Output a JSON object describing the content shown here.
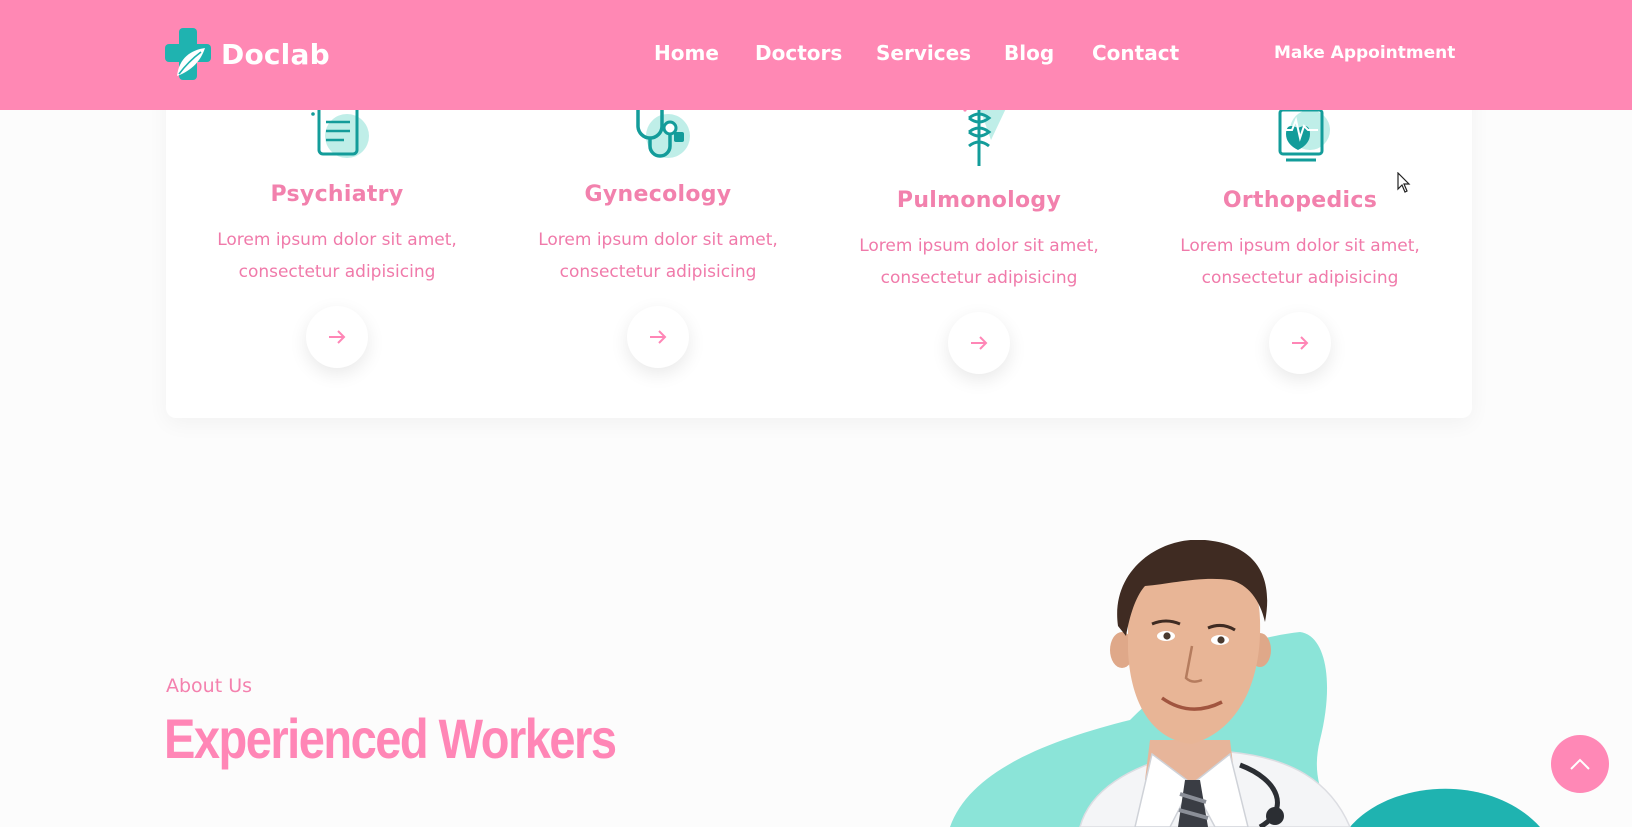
{
  "header": {
    "brand": "Doclab",
    "nav": [
      {
        "label": "Home"
      },
      {
        "label": "Doctors"
      },
      {
        "label": "Services"
      },
      {
        "label": "Blog"
      },
      {
        "label": "Contact"
      }
    ],
    "cta_label": "Make Appointment"
  },
  "services": [
    {
      "title": "Psychiatry",
      "desc_line1": "Lorem ipsum dolor sit amet,",
      "desc_line2": "consectetur adipisicing",
      "icon": "clipboard-icon"
    },
    {
      "title": "Gynecology",
      "desc_line1": "Lorem ipsum dolor sit amet,",
      "desc_line2": "consectetur adipisicing",
      "icon": "stethoscope-icon"
    },
    {
      "title": "Pulmonology",
      "desc_line1": "Lorem ipsum dolor sit amet,",
      "desc_line2": "consectetur adipisicing",
      "icon": "caduceus-icon"
    },
    {
      "title": "Orthopedics",
      "desc_line1": "Lorem ipsum dolor sit amet,",
      "desc_line2": "consectetur adipisicing",
      "icon": "heart-monitor-icon"
    }
  ],
  "about": {
    "kicker": "About Us",
    "title": "Experienced Workers"
  },
  "colors": {
    "header_bg": "#ff88b4",
    "accent_pink": "#ff86b6",
    "teal": "#1fb3b0",
    "mint": "#8be4d8"
  }
}
